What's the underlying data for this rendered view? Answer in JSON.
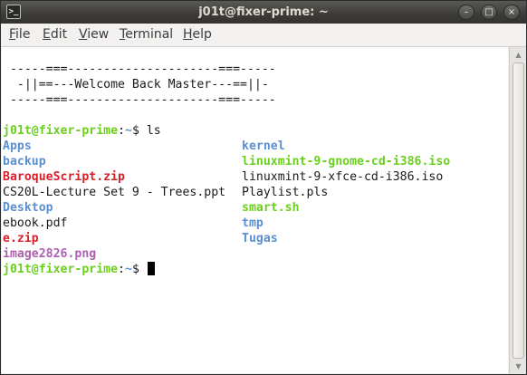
{
  "window": {
    "title": "j01t@fixer-prime: ~",
    "terminal_icon_glyph": ">_",
    "controls": {
      "minimize": "–",
      "maximize": "□",
      "close": "×"
    }
  },
  "menu": {
    "file": {
      "mnemonic": "F",
      "rest": "ile"
    },
    "edit": {
      "mnemonic": "E",
      "rest": "dit"
    },
    "view": {
      "mnemonic": "V",
      "rest": "iew"
    },
    "terminal": {
      "mnemonic": "T",
      "rest": "erminal"
    },
    "help": {
      "mnemonic": "H",
      "rest": "elp"
    }
  },
  "banner": [
    " -----===---------------------===-----",
    "  -||==---Welcome Back Master---==||-",
    " -----===---------------------===-----"
  ],
  "prompt": {
    "user_host": "j01t@fixer-prime",
    "sep": ":",
    "path": "~",
    "symbol": "$ "
  },
  "command": "ls",
  "listing": {
    "col1": [
      {
        "name": "Apps",
        "type": "dir"
      },
      {
        "name": "backup",
        "type": "dir"
      },
      {
        "name": "BaroqueScript.zip",
        "type": "archive"
      },
      {
        "name": "CS20L-Lecture Set 9 - Trees.ppt",
        "type": "file"
      },
      {
        "name": "Desktop",
        "type": "dir"
      },
      {
        "name": "ebook.pdf",
        "type": "file"
      },
      {
        "name": "e.zip",
        "type": "archive"
      },
      {
        "name": "image2826.png",
        "type": "image"
      }
    ],
    "col2": [
      {
        "name": "kernel",
        "type": "dir"
      },
      {
        "name": "linuxmint-9-gnome-cd-i386.iso",
        "type": "executable"
      },
      {
        "name": "linuxmint-9-xfce-cd-i386.iso",
        "type": "file"
      },
      {
        "name": "Playlist.pls",
        "type": "file"
      },
      {
        "name": "smart.sh",
        "type": "executable"
      },
      {
        "name": "tmp",
        "type": "dir"
      },
      {
        "name": "Tugas",
        "type": "dir"
      }
    ]
  },
  "colors": {
    "dir": "#5a8fd0",
    "archive": "#d5202a",
    "executable": "#6ad01c",
    "image": "#ad5fb0",
    "file": "#1a1a1a"
  }
}
